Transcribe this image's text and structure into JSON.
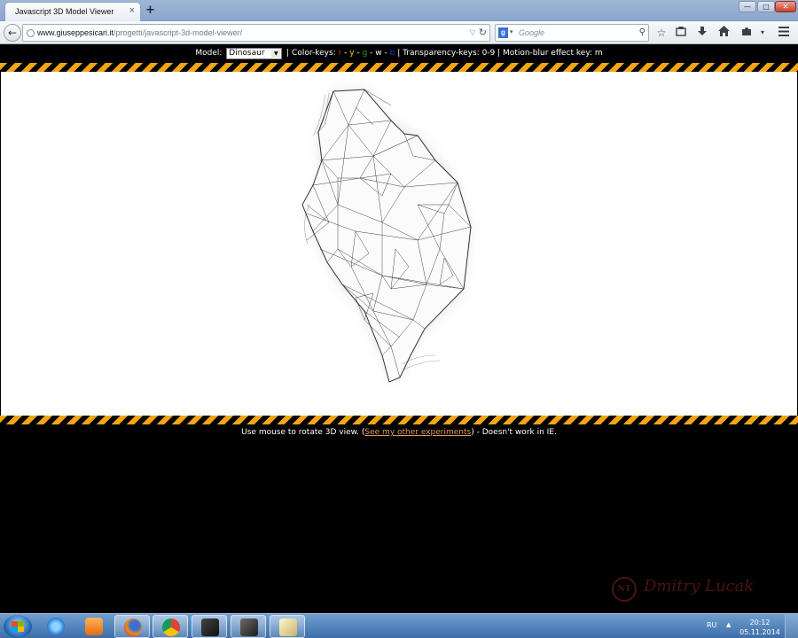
{
  "browser": {
    "tab_title": "Javascript 3D Model Viewer",
    "tab_close": "×",
    "new_tab": "+",
    "url_host": "www.giuseppesicari.it",
    "url_path": "/progetti/javascript-3d-model-viewer/",
    "search_placeholder": "Google",
    "search_engine_letter": "g"
  },
  "icons": {
    "back": "arrow-left-icon",
    "globe": "globe-icon",
    "reload": "reload-icon",
    "bookmark": "star-icon",
    "clipboard": "clipboard-icon",
    "download": "download-icon",
    "home": "home-icon",
    "menu": "hamburger-menu-icon"
  },
  "controls": {
    "model_label": "Model:",
    "model_selected": "Dinosaur",
    "color_keys_label": "| Color-keys:",
    "keys": [
      {
        "key": "r",
        "color": "#e0242b"
      },
      {
        "key": "y",
        "color": "#e6d21a"
      },
      {
        "key": "g",
        "color": "#2e9a35"
      },
      {
        "key": "w",
        "color": "#ffffff"
      },
      {
        "key": "b",
        "color": "#2436c8"
      }
    ],
    "separator": " - ",
    "transparency": "| Transparency-keys: 0-9 |",
    "motion_blur": "Motion-blur effect key: m"
  },
  "footer": {
    "before_link": "Use mouse to rotate 3D view. (",
    "link_text": "See my other experiments",
    "after_link": ") - Doesn't work in IE."
  },
  "watermark": {
    "badge": "NT",
    "name": "Dmitry Lucak"
  },
  "taskbar": {
    "language": "RU",
    "time": "20:12",
    "date": "05.11.2014"
  },
  "colors": {
    "stripe_yellow": "#f4a516",
    "link": "#e39a5c"
  }
}
